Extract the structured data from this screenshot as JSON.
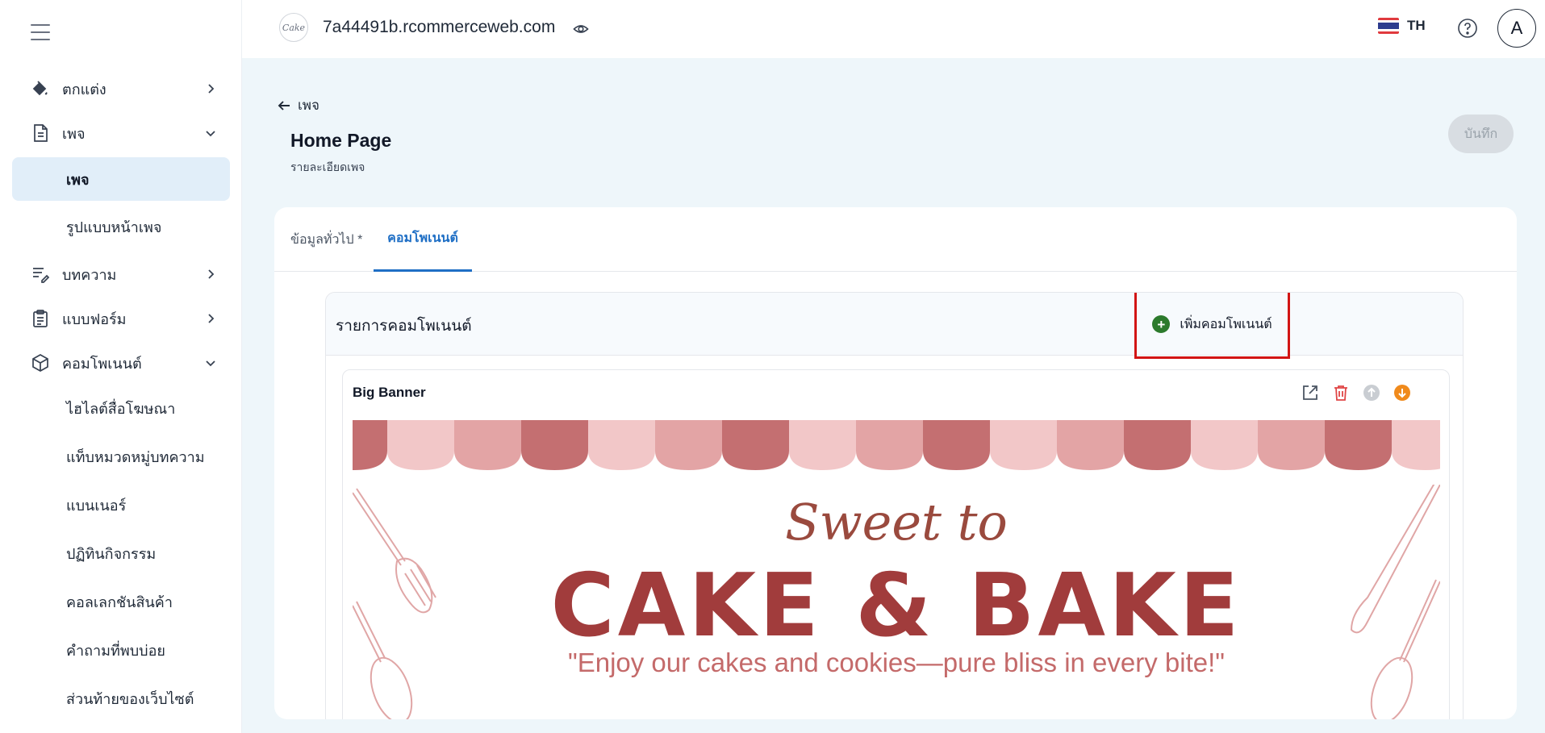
{
  "sidebar": {
    "items": [
      {
        "label": "ตกแต่ง",
        "icon": "paint-bucket-icon"
      },
      {
        "label": "เพจ",
        "icon": "page-icon"
      },
      {
        "label": "เพจ",
        "active": true
      },
      {
        "label": "รูปแบบหน้าเพจ"
      },
      {
        "label": "บทความ",
        "icon": "article-icon"
      },
      {
        "label": "แบบฟอร์ม",
        "icon": "form-icon"
      },
      {
        "label": "คอมโพเนนต์",
        "icon": "cube-icon"
      },
      {
        "label": "ไฮไลต์สื่อโฆษณา"
      },
      {
        "label": "แท็บหมวดหมู่บทความ"
      },
      {
        "label": "แบนเนอร์"
      },
      {
        "label": "ปฏิทินกิจกรรม"
      },
      {
        "label": "คอลเลกชันสินค้า"
      },
      {
        "label": "คำถามที่พบบ่อย"
      },
      {
        "label": "ส่วนท้ายของเว็บไซต์"
      }
    ]
  },
  "topbar": {
    "domain": "7a44491b.rcommerceweb.com",
    "logo_text": "Cake",
    "language": "TH",
    "avatar_initial": "A"
  },
  "header": {
    "back_label": "เพจ",
    "title": "Home Page",
    "subtitle": "รายละเอียดเพจ",
    "save_label": "บันทึก"
  },
  "tabs": [
    {
      "label": "ข้อมูลทั่วไป *"
    },
    {
      "label": "คอมโพเนนต์",
      "active": true
    }
  ],
  "components": {
    "title": "รายการคอมโพเนนต์",
    "add_label": "เพิ่มคอมโพเนนต์",
    "item": {
      "name": "Big Banner",
      "banner": {
        "script": "Sweet to",
        "headline": "CAKE & BAKE",
        "quote": "\"Enjoy our cakes and cookies—pure bliss in every bite!\""
      }
    }
  },
  "colors": {
    "accent": "#1f6fc5",
    "active_bg": "#e1eef9",
    "add_highlight": "#d21414",
    "add_icon": "#2c7a2c",
    "delete": "#e04545",
    "move_down": "#f08a1c",
    "banner_text": "#a13c3c"
  }
}
